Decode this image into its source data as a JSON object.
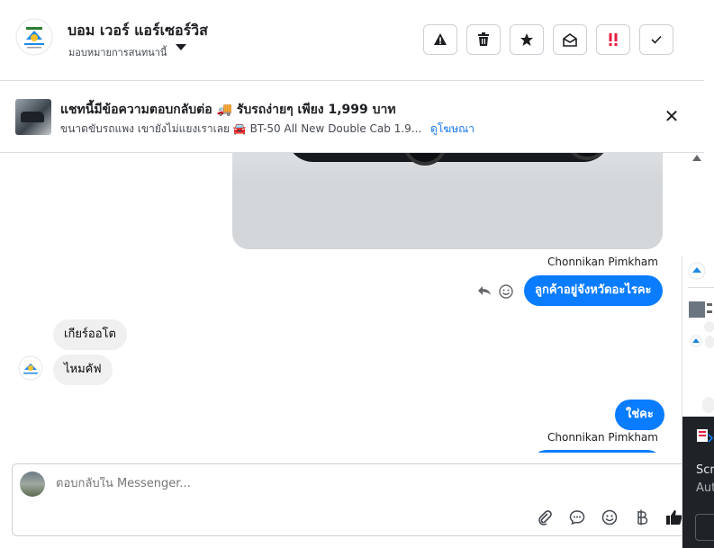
{
  "header": {
    "title": "บอม เวอร์ แอร์เซอร์วิส",
    "subtitle": "มอบหมายการสนทนานี้",
    "actions": [
      {
        "name": "report-spam",
        "icon": "warning-icon",
        "glyph": "⚠"
      },
      {
        "name": "delete",
        "icon": "trash-icon",
        "glyph": "🗑"
      },
      {
        "name": "star",
        "icon": "star-icon",
        "glyph": "★"
      },
      {
        "name": "mark-unread",
        "icon": "envelope-open-icon",
        "glyph": "✉"
      },
      {
        "name": "follow-up",
        "icon": "exclamation-icon",
        "glyph": "!!"
      },
      {
        "name": "mark-done",
        "icon": "check-icon",
        "glyph": "✓"
      }
    ]
  },
  "ad": {
    "title": "แชทนี้มีข้อความตอบกลับต่อ 🚚 รับรถง่ายๆ เพียง 1,999 บาท",
    "description": "ขนาดขับรถแพง เขายังไม่แยงเราเลย 🚘 BT-50 All New Double Cab 1.9...",
    "link": "ดูโฆษณา",
    "close_glyph": "✕"
  },
  "messages": {
    "sender_name": "Chonnikan Pimkham",
    "out_1": "ลูกค้าอยู่จังหวัดอะไรคะ",
    "in_1": "เกียร์ออโต",
    "in_2": "ไหมคัฟ",
    "out_2": "ใช่คะ"
  },
  "composer": {
    "placeholder": "ตอบกลับใน Messenger...",
    "icons": [
      "attachment-icon",
      "saved-reply-icon",
      "emoji-icon",
      "baht-icon",
      "thumbs-up-icon"
    ]
  },
  "side_panel": {
    "text_1": "Scr",
    "text_2": "Aut"
  },
  "colors": {
    "accent": "#0a7cff",
    "link": "#1877f2",
    "incoming_bubble": "#f0f0f0",
    "follow_up": "#e41e3f"
  }
}
